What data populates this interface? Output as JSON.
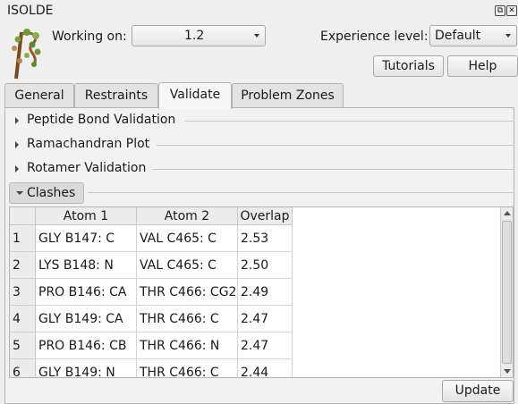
{
  "window": {
    "title": "ISOLDE"
  },
  "header": {
    "working_on_label": "Working on:",
    "working_on_value": "1.2",
    "experience_label": "Experience level:",
    "experience_value": "Default",
    "tutorials_label": "Tutorials",
    "help_label": "Help"
  },
  "tabs": [
    {
      "label": "General"
    },
    {
      "label": "Restraints"
    },
    {
      "label": "Validate",
      "active": true
    },
    {
      "label": "Problem Zones"
    }
  ],
  "sections": [
    {
      "label": "Peptide Bond Validation",
      "expanded": false
    },
    {
      "label": "Ramachandran Plot",
      "expanded": false
    },
    {
      "label": "Rotamer Validation",
      "expanded": false
    },
    {
      "label": "Clashes",
      "expanded": true
    }
  ],
  "clashes": {
    "columns": [
      "Atom 1",
      "Atom 2",
      "Overlap"
    ],
    "rows": [
      {
        "index": "1",
        "atom1": "GLY B147: C",
        "atom2": "VAL C465: C",
        "overlap": "2.53"
      },
      {
        "index": "2",
        "atom1": "LYS B148: N",
        "atom2": "VAL C465: C",
        "overlap": "2.50"
      },
      {
        "index": "3",
        "atom1": "PRO B146: CA",
        "atom2": "THR C466: CG2",
        "overlap": "2.49"
      },
      {
        "index": "4",
        "atom1": "GLY B149: CA",
        "atom2": "THR C466: C",
        "overlap": "2.47"
      },
      {
        "index": "5",
        "atom1": "PRO B146: CB",
        "atom2": "THR C466: N",
        "overlap": "2.47"
      },
      {
        "index": "6",
        "atom1": "GLY B149: N",
        "atom2": "THR C466: C",
        "overlap": "2.44"
      }
    ],
    "update_label": "Update"
  }
}
